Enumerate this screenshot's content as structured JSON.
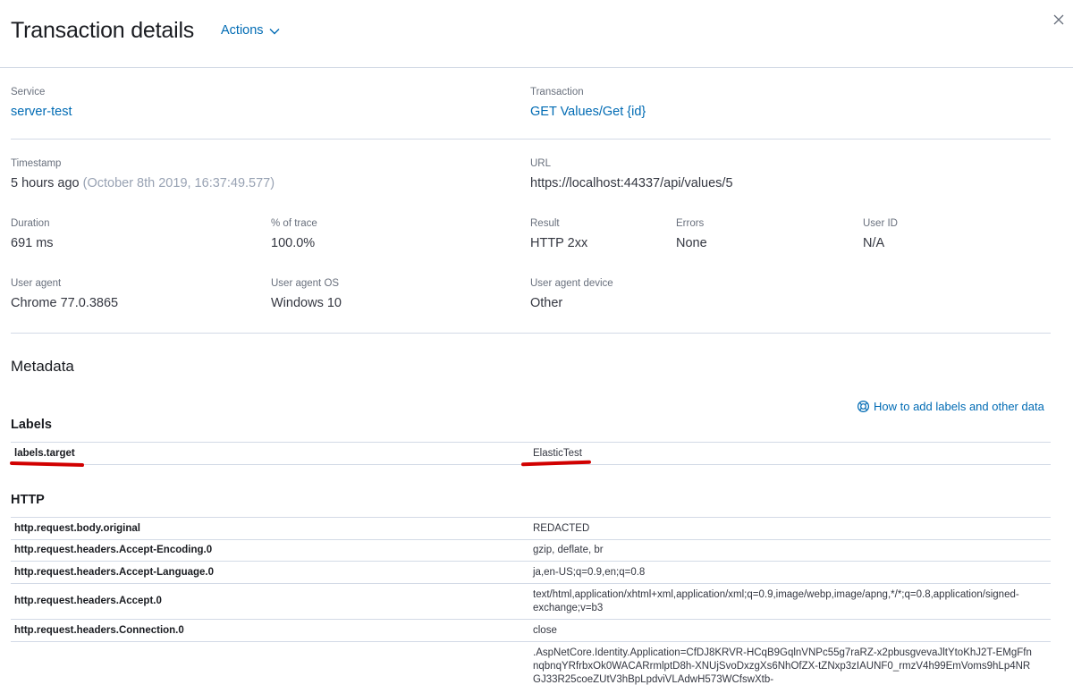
{
  "header": {
    "title": "Transaction details",
    "actions_label": "Actions"
  },
  "summary": {
    "service": {
      "label": "Service",
      "value": "server-test"
    },
    "transaction": {
      "label": "Transaction",
      "value": "GET Values/Get {id}"
    }
  },
  "details": {
    "timestamp": {
      "label": "Timestamp",
      "relative": "5 hours ago",
      "absolute": "(October 8th 2019, 16:37:49.577)"
    },
    "url": {
      "label": "URL",
      "value": "https://localhost:44337/api/values/5"
    },
    "duration": {
      "label": "Duration",
      "value": "691 ms"
    },
    "percent_of_trace": {
      "label": "% of trace",
      "value": "100.0%"
    },
    "result": {
      "label": "Result",
      "value": "HTTP 2xx"
    },
    "errors": {
      "label": "Errors",
      "value": "None"
    },
    "user_id": {
      "label": "User ID",
      "value": "N/A"
    },
    "user_agent": {
      "label": "User agent",
      "value": "Chrome 77.0.3865"
    },
    "user_agent_os": {
      "label": "User agent OS",
      "value": "Windows 10"
    },
    "user_agent_device": {
      "label": "User agent device",
      "value": "Other"
    }
  },
  "metadata": {
    "title": "Metadata",
    "help_link": "How to add labels and other data",
    "labels": {
      "title": "Labels",
      "rows": [
        {
          "key": "labels.target",
          "value": "ElasticTest"
        }
      ]
    },
    "http": {
      "title": "HTTP",
      "rows": [
        {
          "key": "http.request.body.original",
          "value": "REDACTED"
        },
        {
          "key": "http.request.headers.Accept-Encoding.0",
          "value": "gzip, deflate, br"
        },
        {
          "key": "http.request.headers.Accept-Language.0",
          "value": "ja,en-US;q=0.9,en;q=0.8"
        },
        {
          "key": "http.request.headers.Accept.0",
          "value": "text/html,application/xhtml+xml,application/xml;q=0.9,image/webp,image/apng,*/*;q=0.8,application/signed-exchange;v=b3"
        },
        {
          "key": "http.request.headers.Connection.0",
          "value": "close"
        },
        {
          "key": "",
          "value": ".AspNetCore.Identity.Application=CfDJ8KRVR-HCqB9GqlnVNPc55g7raRZ-x2pbusgvevaJltYtoKhJ2T-EMgFfnnqbnqYRfrbxOk0WACARrmlptD8h-XNUjSvoDxzgXs6NhOfZX-tZNxp3zIAUNF0_rmzV4h99EmVoms9hLp4NRGJ33R25coeZUtV3hBpLpdviVLAdwH573WCfswXtb-"
        }
      ]
    }
  },
  "colors": {
    "accent": "#006bb4",
    "annotation": "#d10000"
  }
}
